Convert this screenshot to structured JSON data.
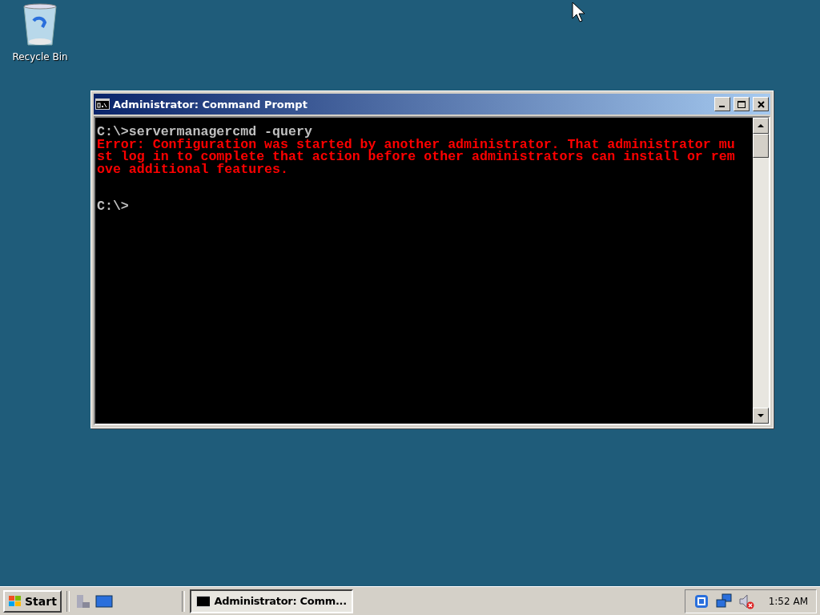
{
  "desktop_icons": [
    {
      "label": "Recycle Bin"
    }
  ],
  "window": {
    "title": "Administrator: Command Prompt",
    "console": {
      "command_line": "C:\\>servermanagercmd -query",
      "error_lines": [
        "Error: Configuration was started by another administrator. That administrator mu",
        "st log in to complete that action before other administrators can install or rem",
        "ove additional features."
      ],
      "prompt": "C:\\>"
    }
  },
  "taskbar": {
    "start": "Start",
    "windows": [
      {
        "label": "Administrator: Comm...",
        "selected": true
      }
    ],
    "clock": "1:52 AM"
  }
}
